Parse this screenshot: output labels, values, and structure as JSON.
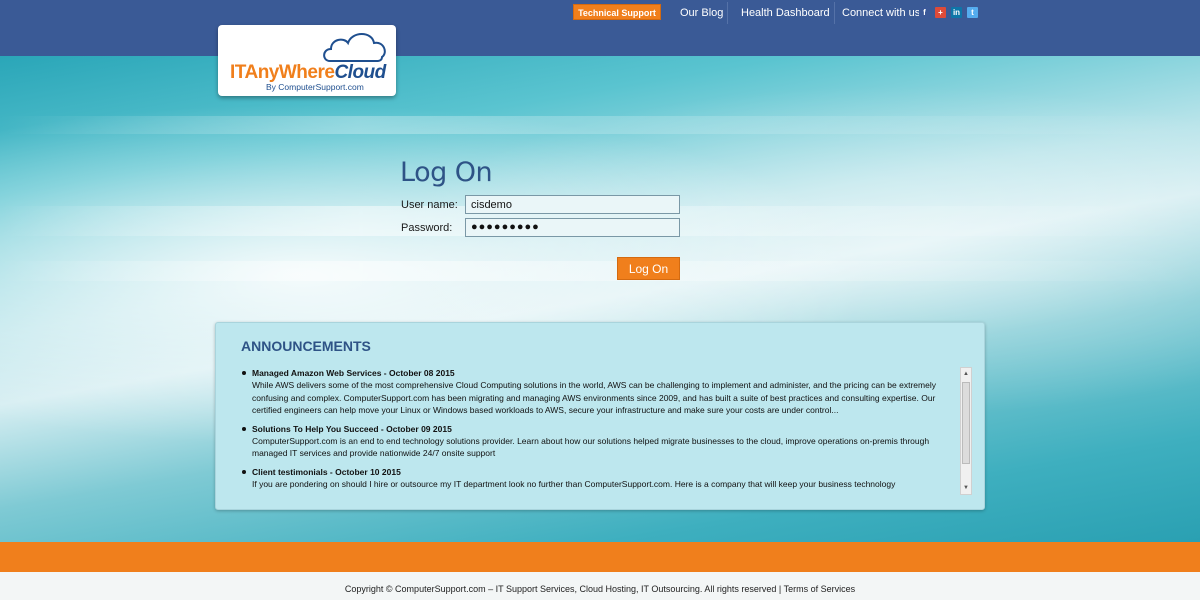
{
  "header": {
    "tech_support": "Technical Support",
    "blog": "Our Blog",
    "health": "Health Dashboard",
    "connect": "Connect with us",
    "social": [
      {
        "icon": "facebook-icon",
        "glyph": "f",
        "color": "#3b5998"
      },
      {
        "icon": "google-plus-icon",
        "glyph": "+",
        "color": "#dd4b39"
      },
      {
        "icon": "linkedin-icon",
        "glyph": "in",
        "color": "#0e76a8"
      },
      {
        "icon": "twitter-icon",
        "glyph": "t",
        "color": "#55acee"
      }
    ]
  },
  "logo": {
    "brand_it": "ITAnyWhere",
    "brand_cloud": "Cloud",
    "subtitle": "By ComputerSupport.com",
    "icon": "cloud-icon"
  },
  "login": {
    "title": "Log On",
    "username_label": "User name:",
    "username_value": "cisdemo",
    "password_label": "Password:",
    "password_value": "●●●●●●●●●",
    "submit_label": "Log On"
  },
  "announcements": {
    "title": "ANNOUNCEMENTS",
    "items": [
      {
        "heading": "Managed Amazon Web Services - October 08 2015",
        "body": "While AWS delivers some of the most comprehensive Cloud Computing solutions in the world, AWS can be challenging to implement and administer, and the pricing can be extremely confusing and complex. ComputerSupport.com has been migrating and managing AWS environments since 2009, and has built a suite of best practices and consulting expertise. Our certified engineers can help move your Linux or Windows based workloads to AWS, secure your infrastructure and make sure your costs are under control..."
      },
      {
        "heading": "Solutions To Help You Succeed - October 09 2015",
        "body": "ComputerSupport.com is an end to end technology solutions provider. Learn about how our solutions helped migrate businesses to the cloud, improve operations on-premis through managed IT services and provide nationwide 24/7 onsite support"
      },
      {
        "heading": "Client testimonials - October 10 2015",
        "body": "If you are pondering on should I hire or outsource my IT department look no further than ComputerSupport.com. Here is a company that will keep your business technology"
      }
    ]
  },
  "footer": {
    "text": "Copyright © ComputerSupport.com – IT Support Services, Cloud Hosting, IT Outsourcing. All rights reserved | Terms of Services"
  },
  "colors": {
    "nav_bg": "#3a5a96",
    "accent_orange": "#f07f1c",
    "title_blue": "#2e5386",
    "announcement_bg": "#bde7ee"
  }
}
